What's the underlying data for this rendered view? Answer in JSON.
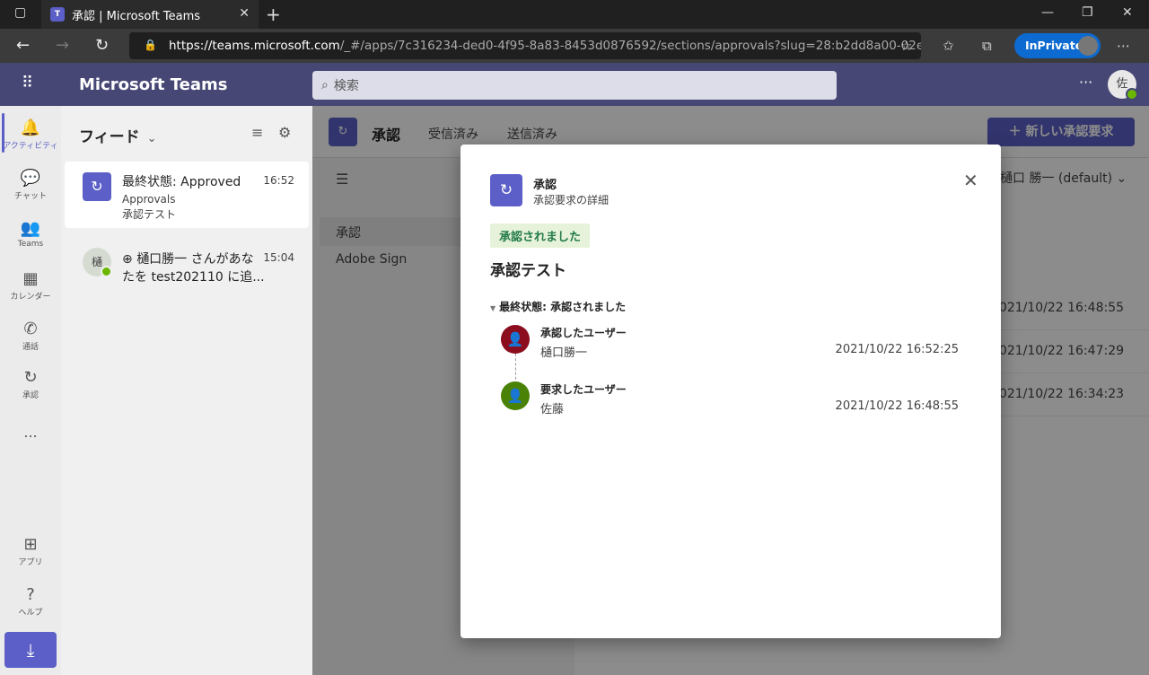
{
  "browser": {
    "tab_title": "承認 | Microsoft Teams",
    "url_host": "https://teams.microsoft.com",
    "url_path": "/_#/apps/7c316234-ded0-4f95-8a83-8453d0876592/sections/approvals?slug=28:b2dd8a00-02e7-4...",
    "inprivate_label": "InPrivate"
  },
  "header": {
    "app_title": "Microsoft Teams",
    "search_placeholder": "検索",
    "avatar_initial": "佐"
  },
  "rail": [
    {
      "label": "アクティビティ"
    },
    {
      "label": "チャット"
    },
    {
      "label": "Teams"
    },
    {
      "label": "カレンダー"
    },
    {
      "label": "通話"
    },
    {
      "label": "承認"
    },
    {
      "label": "..."
    },
    {
      "label": "アプリ"
    },
    {
      "label": "ヘルプ"
    }
  ],
  "feed": {
    "title": "フィード",
    "items": [
      {
        "title": "最終状態: Approved",
        "line2": "Approvals",
        "line3": "承認テスト",
        "time": "16:52"
      },
      {
        "title": "樋口勝一 さんがあな",
        "line2": "たを test202110 に追...",
        "time": "15:04",
        "avatar": "樋"
      }
    ]
  },
  "main": {
    "title": "承認",
    "tabs": [
      "受信済み",
      "送信済み"
    ],
    "new_button": "新しい承認要求",
    "side_items": [
      "承認",
      "Adobe Sign"
    ],
    "user_filter": "樋口 勝一 (default)",
    "row_dates": [
      "2021/10/22 16:48:55",
      "2021/10/22 16:47:29",
      "2021/10/22 16:34:23"
    ]
  },
  "dialog": {
    "title": "承認",
    "subtitle": "承認要求の詳細",
    "status_badge": "承認されました",
    "request_title": "承認テスト",
    "final_state": "最終状態: 承認されました",
    "approver": {
      "role": "承認したユーザー",
      "name": "樋口勝一",
      "date": "2021/10/22 16:52:25",
      "color": "#8b0d1e"
    },
    "requester": {
      "role": "要求したユーザー",
      "name": "佐藤",
      "date": "2021/10/22 16:48:55",
      "color": "#498205"
    }
  }
}
